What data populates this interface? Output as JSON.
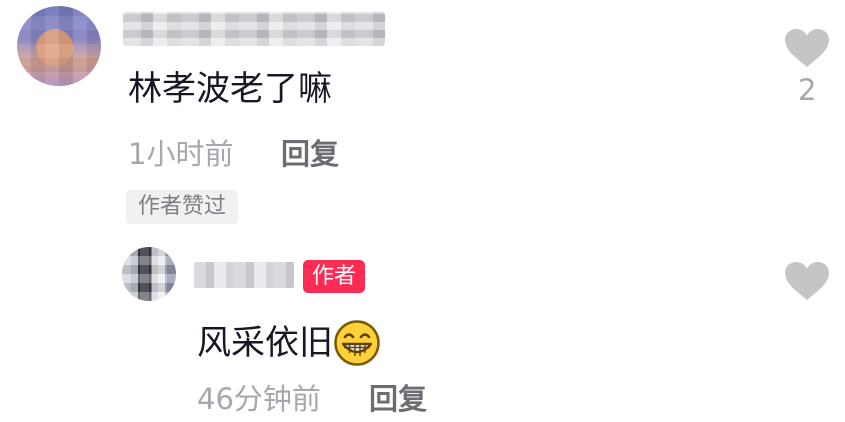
{
  "comment": {
    "username": "",
    "text": "林孝波老了嘛",
    "time": "1小时前",
    "reply_label": "回复",
    "author_liked_badge": "作者赞过",
    "like_count": "2"
  },
  "reply": {
    "username": "",
    "author_badge": "作者",
    "text": "风采依旧",
    "emoji": "grinning-face",
    "time": "46分钟前",
    "reply_label": "回复"
  },
  "colors": {
    "text_primary": "#161823",
    "text_secondary": "#a7a8ad",
    "reply_button": "#6c6d73",
    "author_badge_bg": "#fe2c55",
    "heart_gray": "#c5c5c7"
  }
}
